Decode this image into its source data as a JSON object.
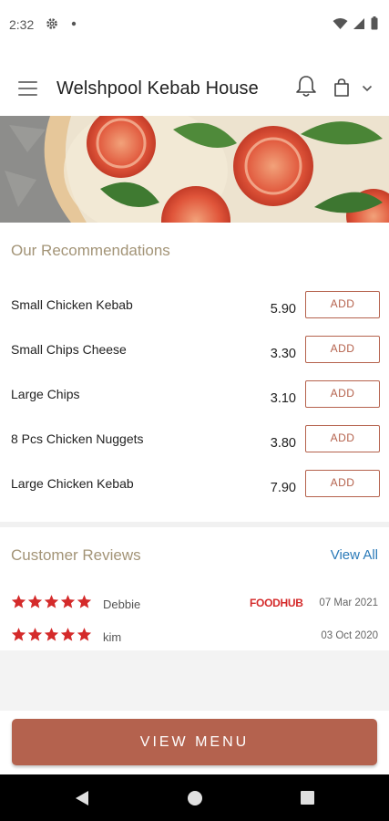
{
  "status_bar": {
    "time": "2:32",
    "icons": [
      "settings-icon",
      "notification-dot-icon",
      "wifi-icon",
      "signal-icon",
      "battery-icon"
    ]
  },
  "header": {
    "title": "Welshpool Kebab House",
    "icons": [
      "menu-icon",
      "bell-icon",
      "bag-icon",
      "chevron-down-icon"
    ]
  },
  "recommendations": {
    "title": "Our Recommendations",
    "add_label": "ADD",
    "items": [
      {
        "name": "Small Chicken Kebab",
        "price": "5.90"
      },
      {
        "name": "Small Chips Cheese",
        "price": "3.30"
      },
      {
        "name": "Large Chips",
        "price": "3.10"
      },
      {
        "name": "8 Pcs Chicken Nuggets",
        "price": "3.80"
      },
      {
        "name": "Large Chicken Kebab",
        "price": "7.90"
      }
    ]
  },
  "reviews": {
    "title": "Customer Reviews",
    "view_all": "View All",
    "items": [
      {
        "stars": 5,
        "name": "Debbie",
        "source": "FOODHUB",
        "date": "07 Mar 2021"
      },
      {
        "stars": 5,
        "name": "kim",
        "source": "",
        "date": "03 Oct 2020"
      }
    ]
  },
  "cta": {
    "label": "VIEW MENU"
  },
  "colors": {
    "accent": "#b4624e",
    "section_title": "#a39477",
    "link": "#2a7ab8",
    "star": "#d42a2a"
  }
}
